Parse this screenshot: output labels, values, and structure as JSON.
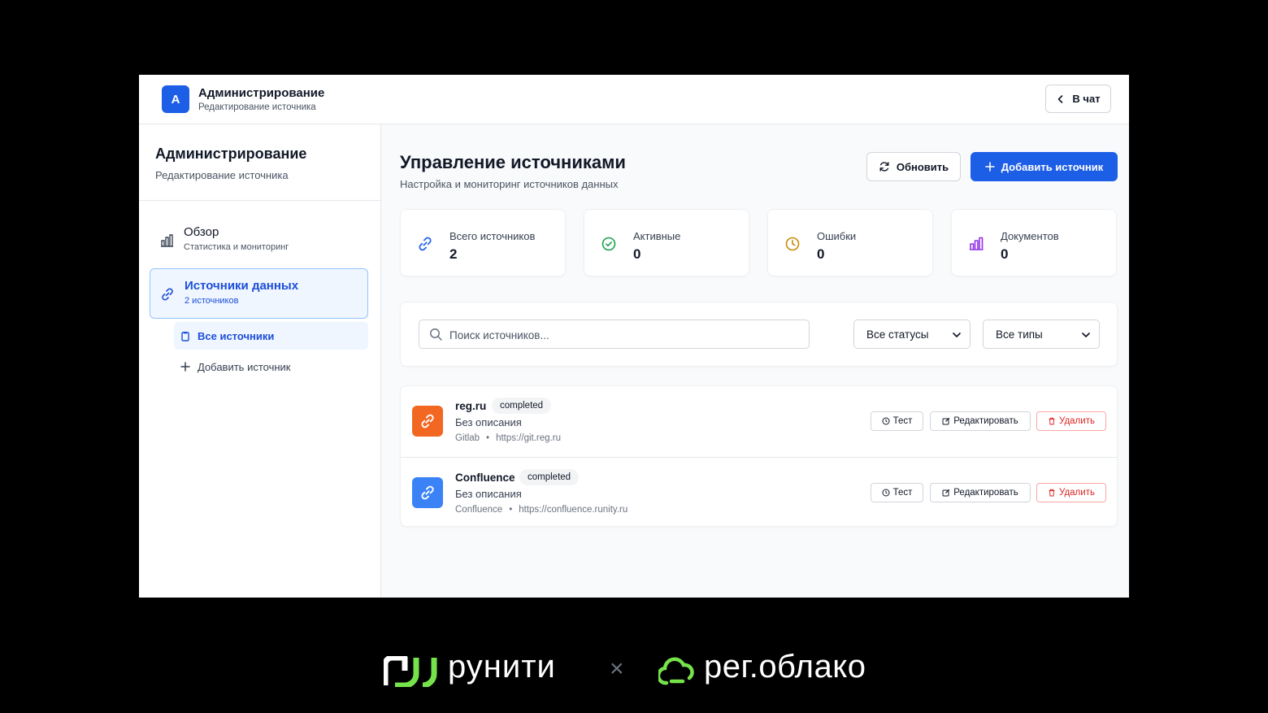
{
  "header": {
    "avatar_letter": "A",
    "title": "Администрирование",
    "subtitle": "Редактирование источника",
    "back_label": "В чат"
  },
  "sidebar": {
    "title": "Администрирование",
    "subtitle": "Редактирование источника",
    "items": [
      {
        "label": "Обзор",
        "sub": "Статистика и мониторинг",
        "icon": "bar-chart-icon",
        "active": false
      },
      {
        "label": "Источники данных",
        "sub": "2 источников",
        "icon": "link-icon",
        "active": true
      }
    ],
    "subitems": [
      {
        "label": "Все источники",
        "icon": "clipboard-icon",
        "active": true
      },
      {
        "label": "Добавить источник",
        "icon": "plus-icon",
        "active": false
      }
    ]
  },
  "main": {
    "title": "Управление источниками",
    "subtitle": "Настройка и мониторинг источников данных",
    "refresh_label": "Обновить",
    "add_label": "Добавить источник",
    "stats": [
      {
        "label": "Всего источников",
        "value": "2",
        "icon": "link-icon",
        "color": "#2563eb"
      },
      {
        "label": "Активные",
        "value": "0",
        "icon": "check-circle-icon",
        "color": "#16a34a"
      },
      {
        "label": "Ошибки",
        "value": "0",
        "icon": "clock-icon",
        "color": "#ca8a04"
      },
      {
        "label": "Документов",
        "value": "0",
        "icon": "bar-chart-icon",
        "color": "#9333ea"
      }
    ],
    "search_placeholder": "Поиск источников...",
    "status_filter": "Все статусы",
    "type_filter": "Все типы",
    "sources": [
      {
        "name": "reg.ru",
        "status": "completed",
        "description": "Без описания",
        "type": "Gitlab",
        "url": "https://git.reg.ru",
        "icon_color": "#f26722"
      },
      {
        "name": "Confluence",
        "status": "completed",
        "description": "Без описания",
        "type": "Confluence",
        "url": "https://confluence.runity.ru",
        "icon_color": "#3b82f6"
      }
    ],
    "actions": {
      "test": "Тест",
      "edit": "Редактировать",
      "delete": "Удалить"
    }
  },
  "footer": {
    "brand_left": "рунити",
    "separator": "×",
    "brand_right": "рег.облако"
  },
  "colors": {
    "accent": "#1d5ee6",
    "danger": "#dc2626",
    "brand_green": "#76e34b"
  }
}
